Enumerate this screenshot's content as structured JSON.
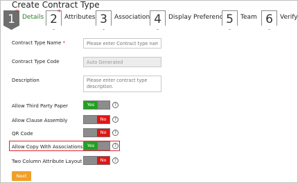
{
  "title": "Create Contract Type",
  "steps": [
    {
      "num": "1",
      "label": "Details",
      "required": "*"
    },
    {
      "num": "2",
      "label": "Attributes",
      "required": "*"
    },
    {
      "num": "3",
      "label": "Association"
    },
    {
      "num": "4",
      "label": "Display Preference"
    },
    {
      "num": "5",
      "label": "Team"
    },
    {
      "num": "6",
      "label": "Verify"
    }
  ],
  "form": {
    "name": {
      "label": "Contract Type Name",
      "required": "*",
      "placeholder": "Please enter Contract type name."
    },
    "code": {
      "label": "Contract Type Code",
      "value": "Auto Generated"
    },
    "description": {
      "label": "Description",
      "placeholder": "Please enter contract type description."
    },
    "third_party": {
      "label": "Allow Third Party Paper",
      "state": "Yes"
    },
    "clause_assembly": {
      "label": "Allow Clause Assembly",
      "state": "No"
    },
    "qr_code": {
      "label": "QR Code",
      "state": "No"
    },
    "copy_assoc": {
      "label": "Allow Copy With Associations",
      "state": "Yes"
    },
    "two_column": {
      "label": "Two Column Attribute Layout",
      "state": "No"
    },
    "yes_label": "Yes",
    "no_label": "No",
    "help_glyph": "?"
  },
  "next_button": "Next",
  "colors": {
    "yes": "#22a022",
    "no": "#e01616",
    "next": "#f0a028",
    "highlight": "#d9252b",
    "active_step": "#6e6e6e"
  }
}
